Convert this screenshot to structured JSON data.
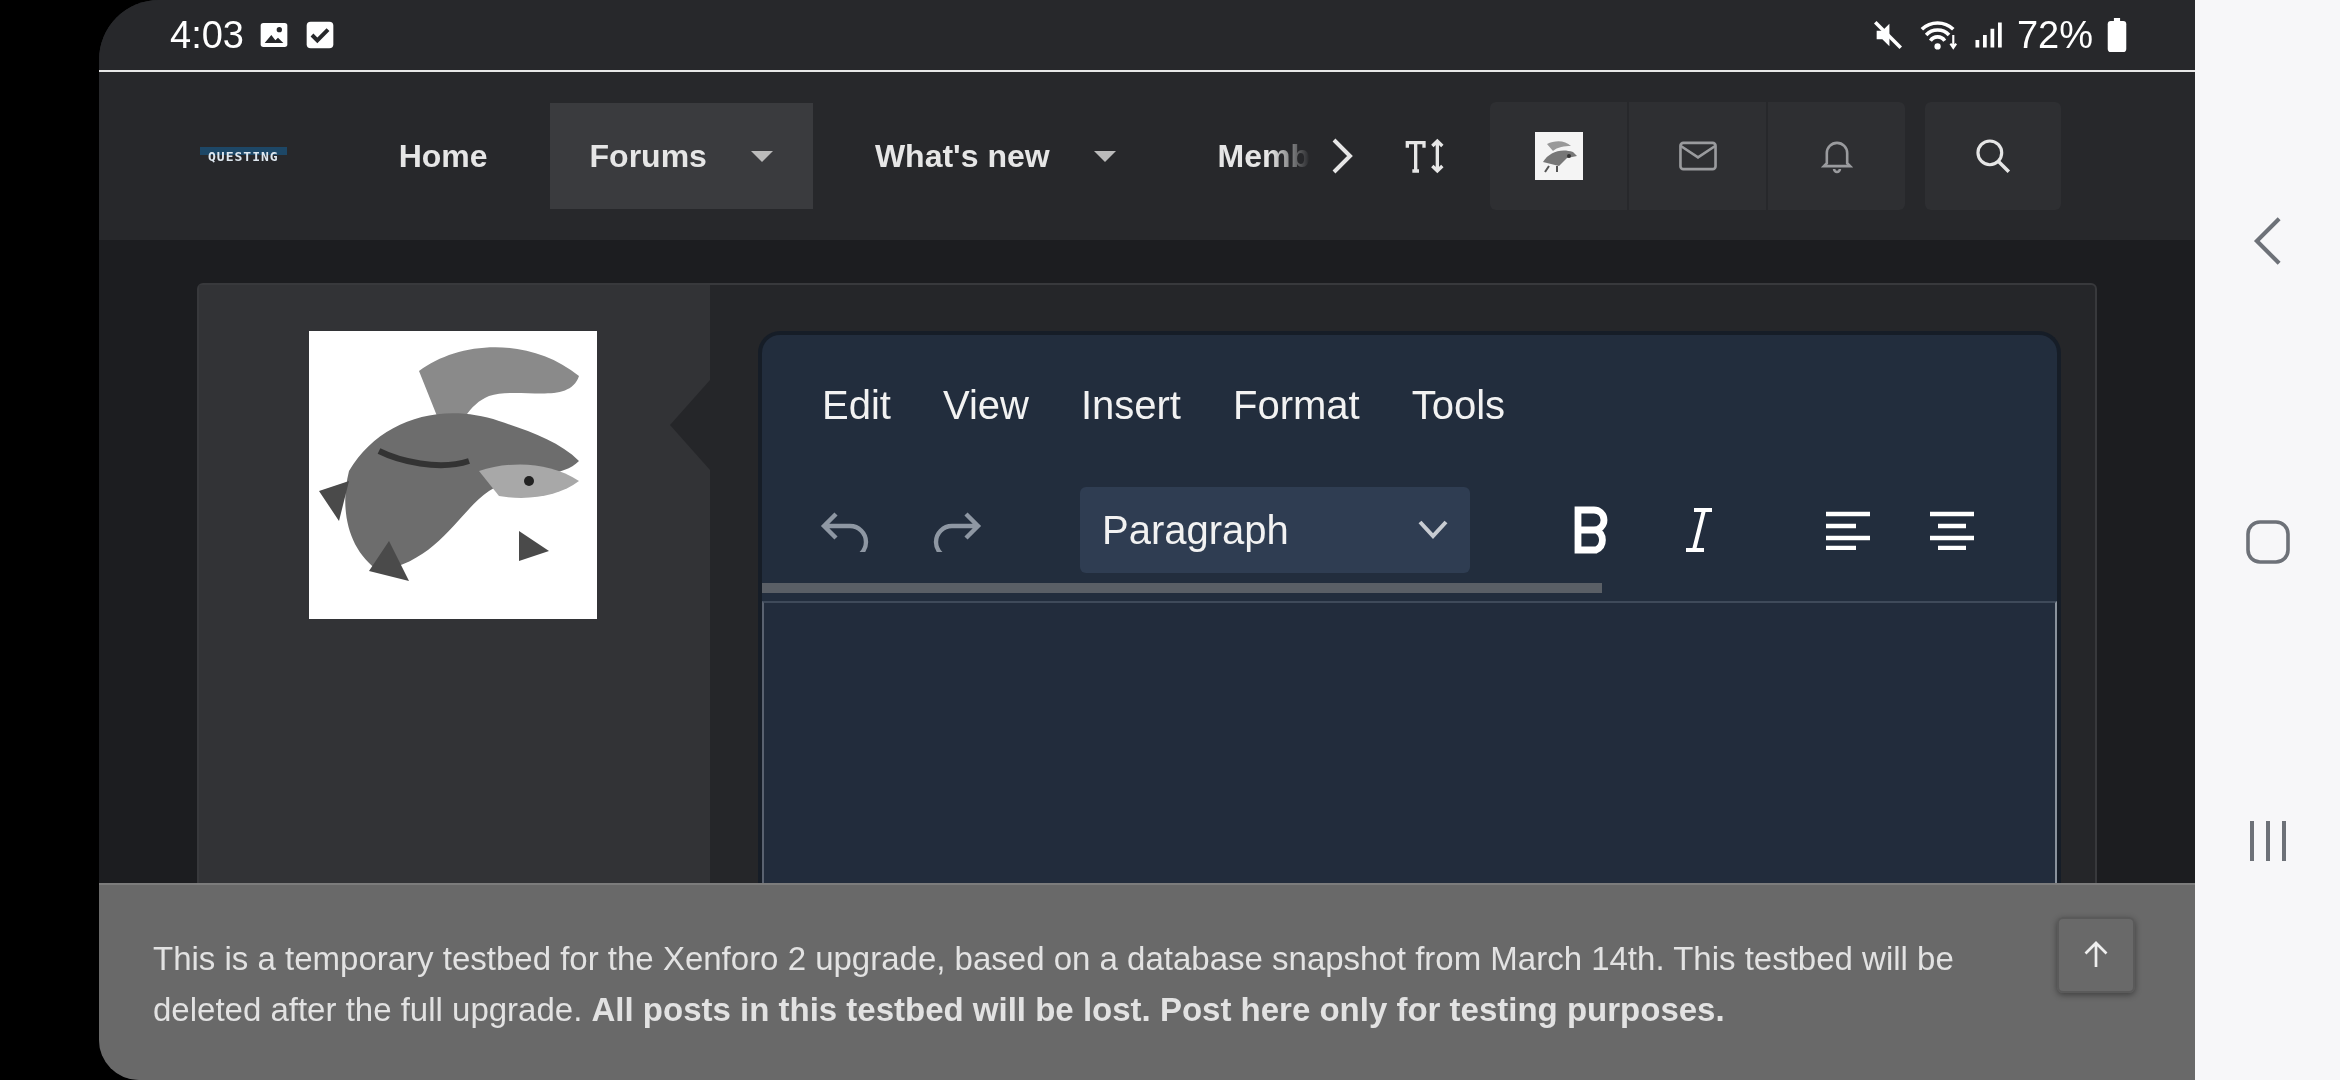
{
  "status_bar": {
    "time": "4:03",
    "battery": "72%"
  },
  "header": {
    "logo": "QUESTING",
    "tabs": [
      {
        "label": "Home",
        "selected": false,
        "dropdown": false
      },
      {
        "label": "Forums",
        "selected": true,
        "dropdown": true
      },
      {
        "label": "What's new",
        "selected": false,
        "dropdown": true
      },
      {
        "label": "Memb",
        "selected": false,
        "dropdown": false
      }
    ]
  },
  "editor": {
    "menu": [
      "Edit",
      "View",
      "Insert",
      "Format",
      "Tools"
    ],
    "block_format": "Paragraph"
  },
  "notice": {
    "text": "This is a temporary testbed for the Xenforo 2 upgrade, based on a database snapshot from March 14th. This testbed will be deleted after the full upgrade. **All posts in this testbed will be lost. Post here only for testing purposes.**"
  }
}
